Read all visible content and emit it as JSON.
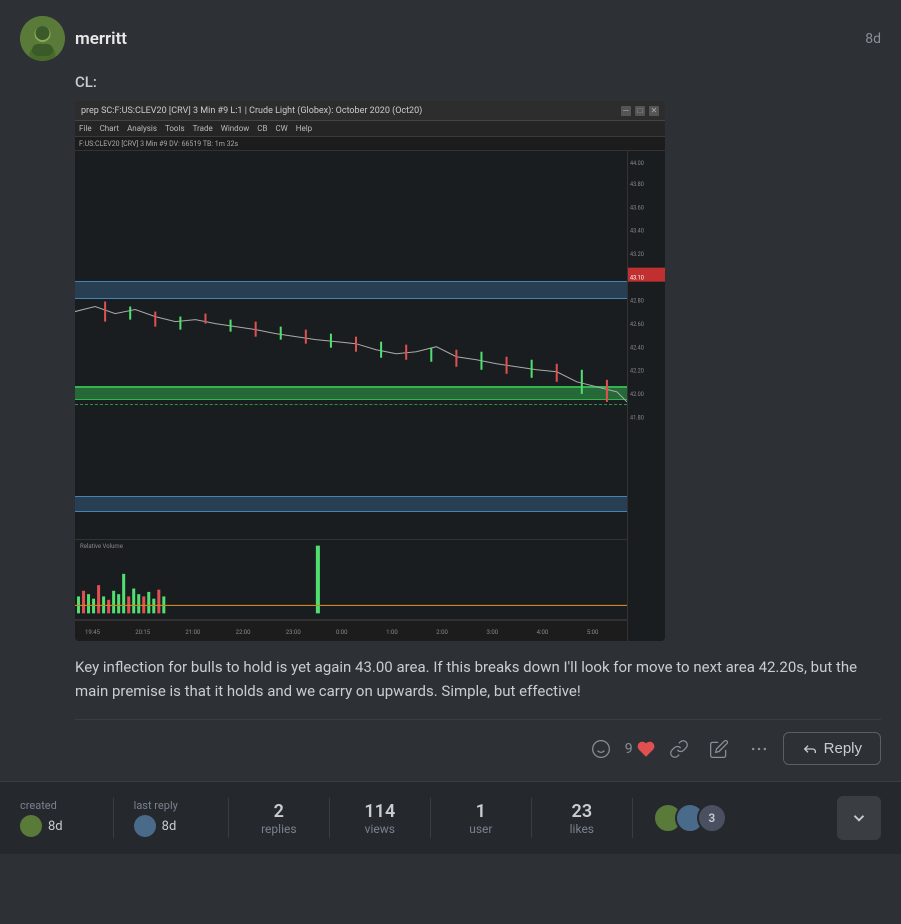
{
  "post": {
    "username": "merritt",
    "time_ago": "8d",
    "label": "CL:",
    "body_text": "Key inflection for bulls to hold is yet again 43.00 area. If this breaks down I'll look for move to next area 42.20s, but the main premise is that it holds and we carry on upwards. Simple, but effective!",
    "like_count": "9",
    "reply_label": "Reply"
  },
  "actions": {
    "emoji_title": "emoji reaction",
    "link_title": "copy link",
    "edit_title": "edit",
    "more_title": "more"
  },
  "footer": {
    "created_label": "created",
    "created_time": "8d",
    "last_reply_label": "last reply",
    "last_reply_time": "8d",
    "replies_count": "2",
    "replies_label": "replies",
    "views_count": "114",
    "views_label": "views",
    "user_count": "1",
    "user_label": "user",
    "likes_count": "23",
    "likes_label": "likes",
    "participant_count": "3"
  },
  "chart": {
    "title": "prep  SC:F:US:CLEV20 [CRV]  3 Min  #9  L:1 | Crude Light (Globex): October 2020 (Oct20)",
    "menubar": [
      "File",
      "Chart",
      "Analysis",
      "Tools",
      "Trade",
      "Window",
      "CB",
      "CW",
      "Help"
    ],
    "info_bar": "F:US:CLEV20 [CRV]  3 Min  #9 DV: 66519 TB: 1m 32s",
    "price_high": "44.00",
    "price_low": "41.80",
    "volume_label": "Relative Volume"
  }
}
